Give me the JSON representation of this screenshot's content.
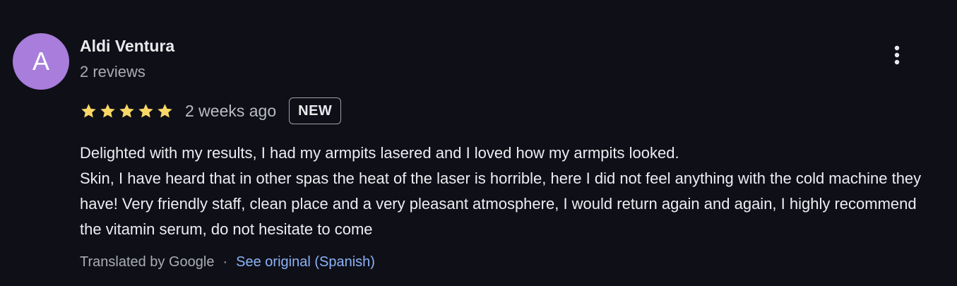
{
  "reviewer": {
    "avatar_letter": "A",
    "avatar_color": "#a87ddc",
    "name": "Aldi Ventura",
    "review_count": "2 reviews"
  },
  "rating": {
    "stars": 5,
    "max_stars": 5,
    "star_color": "#f8d866"
  },
  "date": "2 weeks ago",
  "badge": "NEW",
  "more_options_icon": "more-vert-icon",
  "review_text": {
    "line1": "Delighted with my results, I had my armpits lasered and I loved how my armpits looked.",
    "line2": "Skin, I have heard that in other spas the heat of the laser is horrible, here I did not feel anything with the cold machine they have! Very friendly staff, clean place and a very pleasant atmosphere, I would return again and again, I highly recommend the vitamin serum, do not hesitate to come"
  },
  "translation": {
    "label": "Translated by Google",
    "separator": "·",
    "link": "See original (Spanish)",
    "link_color": "#8ab4f8"
  }
}
